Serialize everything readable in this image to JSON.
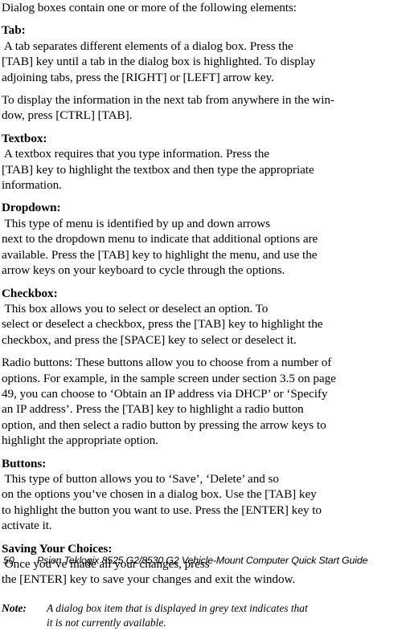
{
  "document": {
    "body_paragraphs": [
      {
        "id": "intro",
        "run_in_heading": "",
        "lines": [
          "Dialog boxes contain one or more of the following elements:"
        ]
      },
      {
        "id": "tab",
        "run_in_heading": "Tab:",
        "lines": [
          " A tab separates different elements of a dialog box. Press the",
          "[TAB] key until a tab in the dialog box is highlighted. To display",
          "adjoining tabs, press the [RIGHT] or [LEFT] arrow key."
        ]
      },
      {
        "id": "next-tab",
        "run_in_heading": "",
        "lines": [
          "To display the information in the next tab from anywhere in the win-",
          "dow, press [CTRL] [TAB]."
        ]
      },
      {
        "id": "textbox",
        "run_in_heading": "Textbox:",
        "lines": [
          " A textbox requires that you type information. Press the",
          "[TAB] key to highlight the textbox and then type the appropriate",
          "information."
        ]
      },
      {
        "id": "dropdown",
        "run_in_heading": "Dropdown:",
        "lines": [
          " This type of menu is identified by up and down arrows",
          "next to the dropdown menu to indicate that additional options are",
          "available. Press the [TAB] key to highlight the menu, and use the",
          "arrow keys on your keyboard to cycle through the options."
        ]
      },
      {
        "id": "checkbox",
        "run_in_heading": "Checkbox:",
        "lines": [
          " This box allows you to select or deselect an option. To",
          "select or deselect a checkbox, press the [TAB] key to highlight the",
          "checkbox, and press the [SPACE] key to select or deselect it."
        ]
      },
      {
        "id": "radio-buttons",
        "run_in_heading": "",
        "lines": [
          "Radio buttons: These buttons allow you to choose from a number of",
          "options. For example, in the sample screen under section 3.5 on page",
          "49, you can choose to ‘Obtain an IP address via DHCP’ or ‘Specify",
          "an IP address’. Press the [TAB] key to highlight a radio button",
          "option, and then select a radio button by pressing the arrow keys to",
          "highlight the appropriate option."
        ]
      },
      {
        "id": "buttons",
        "run_in_heading": "Buttons:",
        "lines": [
          " This type of button allows you to ‘Save’, ‘Delete’ and so",
          "on the options you’ve chosen in a dialog box. Use the [TAB] key",
          "to highlight the button you want to use. Press the [ENTER] key to",
          "activate it."
        ]
      },
      {
        "id": "saving-your-choices",
        "run_in_heading": "Saving Your Choices:",
        "lines": [
          " Once you’ve made all your changes, press",
          "the [ENTER] key to save your changes and exit the window."
        ]
      }
    ],
    "note": {
      "label": "Note:",
      "lines": [
        "A dialog box item that is displayed in grey text indicates that",
        "it is not currently available."
      ]
    },
    "footer": {
      "page_number": "50",
      "title": "Psion Teklogix 8525 G2/8530 G2 Vehicle-Mount Computer Quick Start Guide"
    }
  }
}
